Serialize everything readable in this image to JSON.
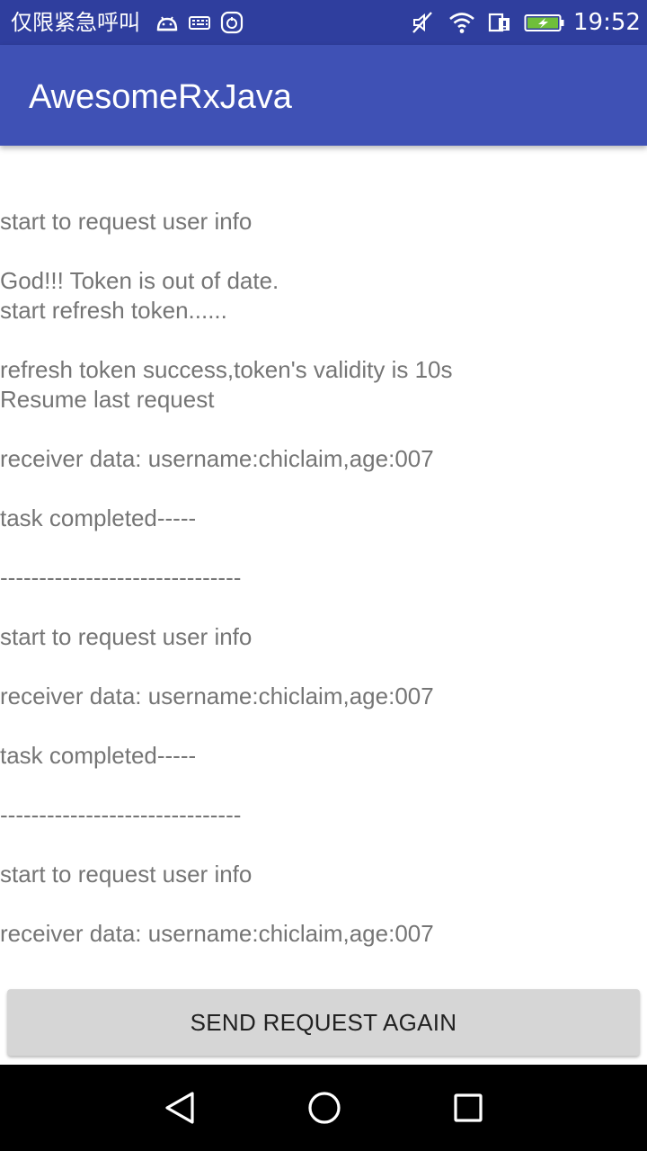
{
  "status_bar": {
    "carrier": "仅限紧急呼叫",
    "time": "19:52",
    "icons": [
      "android-icon",
      "keyboard-icon",
      "app-icon",
      "mute-icon",
      "wifi-icon",
      "sim-icon",
      "battery-charging-icon"
    ]
  },
  "app_bar": {
    "title": "AwesomeRxJava"
  },
  "log": {
    "lines": [
      "start to request user info",
      "",
      "God!!! Token is out of date.",
      "start refresh token......",
      "",
      "refresh token success,token's validity is 10s",
      "Resume last request",
      "",
      "receiver data: username:chiclaim,age:007",
      "",
      "task completed-----",
      "",
      "-------------------------------",
      "",
      "start to request user info",
      "",
      "receiver data: username:chiclaim,age:007",
      "",
      "task completed-----",
      "",
      "-------------------------------",
      "",
      "start to request user info",
      "",
      "receiver data: username:chiclaim,age:007"
    ]
  },
  "button": {
    "label": "SEND REQUEST AGAIN"
  },
  "nav_bar": {
    "icons": [
      "back-icon",
      "home-icon",
      "recents-icon"
    ]
  },
  "colors": {
    "primary": "#3f51b5",
    "primary_dark": "#2f3e9e",
    "text": "#757575",
    "button": "#d6d6d6"
  }
}
